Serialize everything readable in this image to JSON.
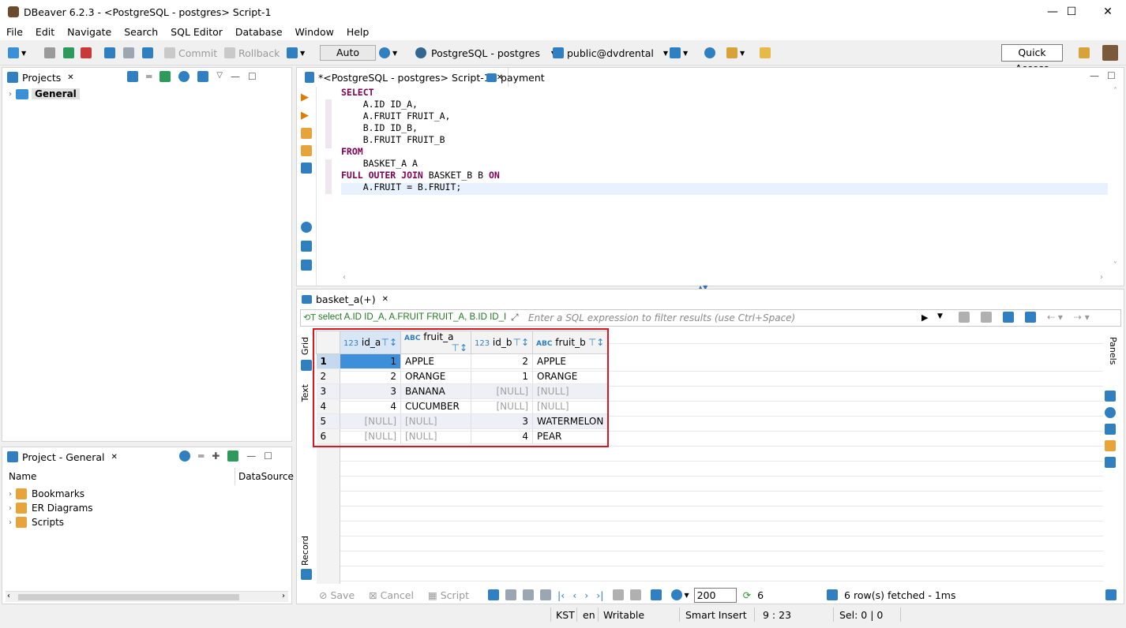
{
  "window": {
    "title": "DBeaver 6.2.3 - <PostgreSQL - postgres> Script-1"
  },
  "menu": [
    "File",
    "Edit",
    "Navigate",
    "Search",
    "SQL Editor",
    "Database",
    "Window",
    "Help"
  ],
  "toolbar": {
    "commit": "Commit",
    "rollback": "Rollback",
    "auto": "Auto",
    "datasource": "PostgreSQL - postgres",
    "schema": "public@dvdrental",
    "quick_access": "Quick Access"
  },
  "projects": {
    "tab": "Projects",
    "root": "General"
  },
  "project_general": {
    "tab": "Project - General",
    "col_name": "Name",
    "col_ds": "DataSource",
    "items": [
      "Bookmarks",
      "ER Diagrams",
      "Scripts"
    ]
  },
  "editor": {
    "tab_script": "*<PostgreSQL - postgres> Script-1",
    "tab_payment": "payment",
    "lines": [
      {
        "kw": "SELECT",
        "text": ""
      },
      {
        "kw": "",
        "text": "    A.ID ID_A,"
      },
      {
        "kw": "",
        "text": "    A.FRUIT FRUIT_A,"
      },
      {
        "kw": "",
        "text": "    B.ID ID_B,"
      },
      {
        "kw": "",
        "text": "    B.FRUIT FRUIT_B"
      },
      {
        "kw": "FROM",
        "text": ""
      },
      {
        "kw": "",
        "text": "    BASKET_A A"
      },
      {
        "kw": "FULL OUTER JOIN",
        "text": " BASKET_B B ",
        "kw2": "ON"
      },
      {
        "kw": "",
        "text": "    A.FRUIT = B.FRUIT;"
      }
    ]
  },
  "results": {
    "tab": "basket_a(+)",
    "filter_query": "select A.ID ID_A, A.FRUIT FRUIT_A, B.ID ID_I",
    "filter_placeholder": "Enter a SQL expression to filter results (use Ctrl+Space)",
    "columns": [
      {
        "type": "123",
        "name": "id_a"
      },
      {
        "type": "ABC",
        "name": "fruit_a"
      },
      {
        "type": "123",
        "name": "id_b"
      },
      {
        "type": "ABC",
        "name": "fruit_b"
      }
    ],
    "rows": [
      [
        "1",
        "1",
        "APPLE",
        "2",
        "APPLE"
      ],
      [
        "2",
        "2",
        "ORANGE",
        "1",
        "ORANGE"
      ],
      [
        "3",
        "3",
        "BANANA",
        "[NULL]",
        "[NULL]"
      ],
      [
        "4",
        "4",
        "CUCUMBER",
        "[NULL]",
        "[NULL]"
      ],
      [
        "5",
        "[NULL]",
        "[NULL]",
        "3",
        "WATERMELON"
      ],
      [
        "6",
        "[NULL]",
        "[NULL]",
        "4",
        "PEAR"
      ]
    ],
    "side_tabs": {
      "grid": "Grid",
      "text": "Text",
      "record": "Record",
      "panels": "Panels"
    },
    "bottom": {
      "save": "Save",
      "cancel": "Cancel",
      "script": "Script",
      "limit": "200",
      "count": "6",
      "fetched": "6 row(s) fetched - 1ms"
    }
  },
  "status": {
    "tz": "KST",
    "lang": "en",
    "mode": "Writable",
    "insert": "Smart Insert",
    "pos": "9 : 23",
    "sel": "Sel: 0 | 0"
  }
}
